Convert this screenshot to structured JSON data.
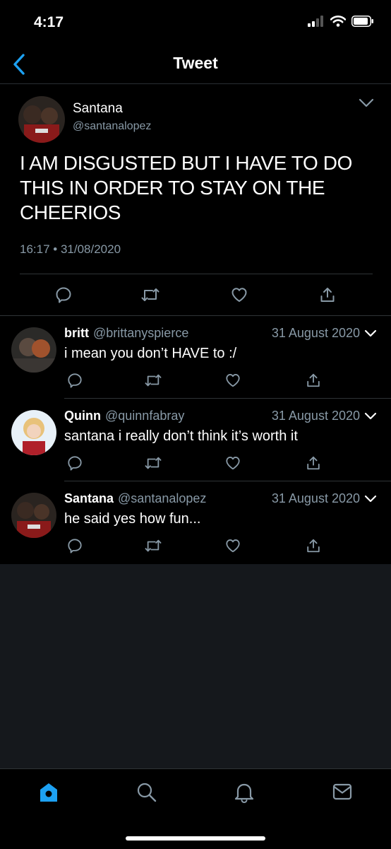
{
  "status_bar": {
    "time": "4:17"
  },
  "nav": {
    "title": "Tweet"
  },
  "main_tweet": {
    "name": "Santana",
    "handle": "@santanalopez",
    "text": "I AM DISGUSTED BUT I HAVE TO DO THIS IN ORDER TO STAY ON THE CHEERIOS",
    "meta": "16:17 • 31/08/2020"
  },
  "replies": [
    {
      "name": "britt",
      "handle": "@brittanyspierce",
      "date": "31 August 2020",
      "text": "i mean you don’t HAVE to :/"
    },
    {
      "name": "Quinn",
      "handle": "@quinnfabray",
      "date": "31 August 2020",
      "text": "santana i really don’t think it’s worth it"
    },
    {
      "name": "Santana",
      "handle": "@santanalopez",
      "date": "31 August 2020",
      "text": "he said yes how fun..."
    }
  ],
  "colors": {
    "accent": "#1da1f2",
    "background": "#000000",
    "empty_area": "#15181c",
    "secondary_text": "#8899a6",
    "icon": "#8899a6"
  },
  "icons": [
    "signal-icon",
    "wifi-icon",
    "battery-icon",
    "back-icon",
    "chevron-down-icon",
    "reply-icon",
    "retweet-icon",
    "like-icon",
    "share-icon",
    "home-icon",
    "search-icon",
    "notifications-icon",
    "messages-icon"
  ]
}
